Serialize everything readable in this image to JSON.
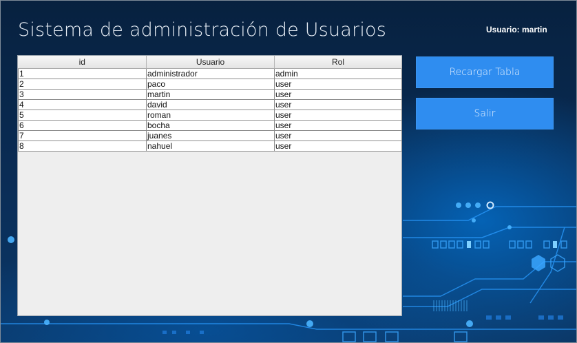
{
  "window": {
    "title": "Sistema de administración de Usuarios",
    "current_user": "Usuario: martin"
  },
  "table": {
    "columns": [
      "id",
      "Usuario",
      "Rol"
    ],
    "rows": [
      [
        "1",
        "administrador",
        "admin"
      ],
      [
        "2",
        "paco",
        "user"
      ],
      [
        "3",
        "martin",
        "user"
      ],
      [
        "4",
        "david",
        "user"
      ],
      [
        "5",
        "roman",
        "user"
      ],
      [
        "6",
        "bocha",
        "user"
      ],
      [
        "7",
        "juanes",
        "user"
      ],
      [
        "8",
        "nahuel",
        "user"
      ]
    ]
  },
  "buttons": {
    "reload": "Recargar Tabla",
    "exit": "Salir"
  },
  "colors": {
    "button_bg": "#2f8df0",
    "background": "#0a2d57"
  }
}
